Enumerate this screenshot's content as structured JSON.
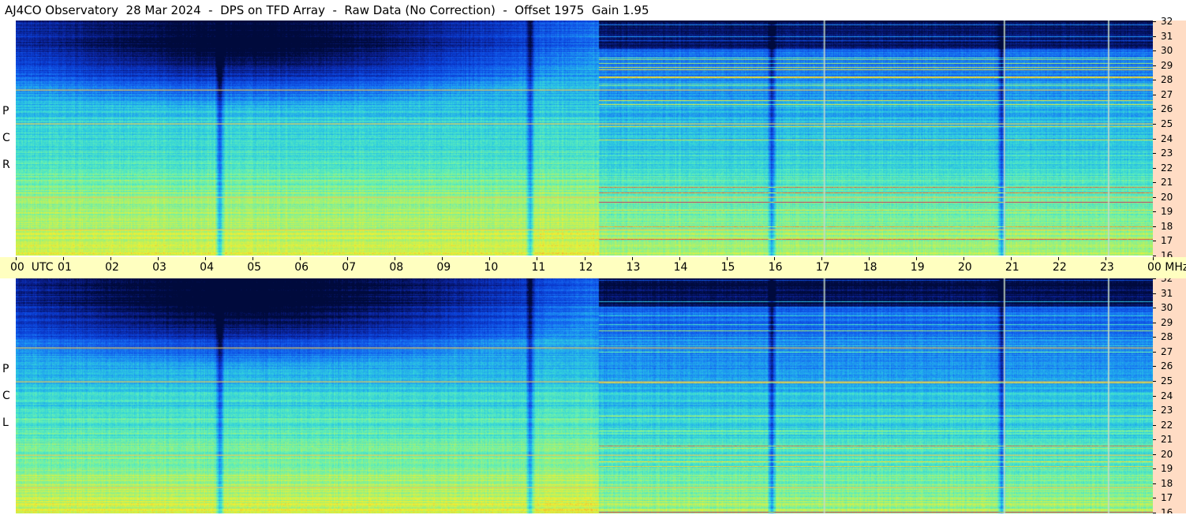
{
  "header": {
    "title": "AJ4CO Observatory  28 Mar 2024  -  DPS on TFD Array  -  Raw Data (No Correction)  -  Offset 1975  Gain 1.95"
  },
  "panels": [
    {
      "id": "rcp",
      "label_letters": [
        "R",
        "C",
        "P"
      ]
    },
    {
      "id": "lcp",
      "label_letters": [
        "L",
        "C",
        "P"
      ]
    }
  ],
  "colors": {
    "time_axis_bg": "#ffffc0",
    "freq_axis_bg": "#ffdcc4",
    "colormap": [
      "#000a3c",
      "#0a1e8c",
      "#0a3cd2",
      "#1464f0",
      "#1ea0f0",
      "#32d2dc",
      "#64f0b4",
      "#b4f064",
      "#f0f032",
      "#f0a032",
      "#e63c3c",
      "#c8326e"
    ]
  },
  "chart_data": {
    "type": "heatmap",
    "title": "",
    "xlabel": "UTC",
    "ylabel": "MHz",
    "x_unit": "UTC",
    "y_unit": "MHz",
    "x_range_hours": [
      0,
      24
    ],
    "y_range_mhz": [
      16,
      32
    ],
    "x_ticks": [
      "00",
      "01",
      "02",
      "03",
      "04",
      "05",
      "06",
      "07",
      "08",
      "09",
      "10",
      "11",
      "12",
      "13",
      "14",
      "15",
      "16",
      "17",
      "18",
      "19",
      "20",
      "21",
      "22",
      "23",
      "00"
    ],
    "x_start_label": "00  UTC",
    "x_end_label": "00 MHz",
    "y_ticks": [
      16,
      17,
      18,
      19,
      20,
      21,
      22,
      23,
      24,
      25,
      26,
      27,
      28,
      29,
      30,
      31,
      32
    ],
    "series": [
      {
        "name": "RCP"
      },
      {
        "name": "LCP"
      }
    ],
    "features": {
      "persistent_lines_mhz": [
        27.3,
        25.0,
        20.0,
        17.8
      ],
      "vertical_lines_hours": [
        17.05,
        20.85,
        23.05
      ],
      "dark_columns_hours": [
        4.3,
        10.85,
        15.95,
        20.8
      ],
      "noise_boundary_hours": [
        10.8,
        12.3
      ]
    }
  }
}
